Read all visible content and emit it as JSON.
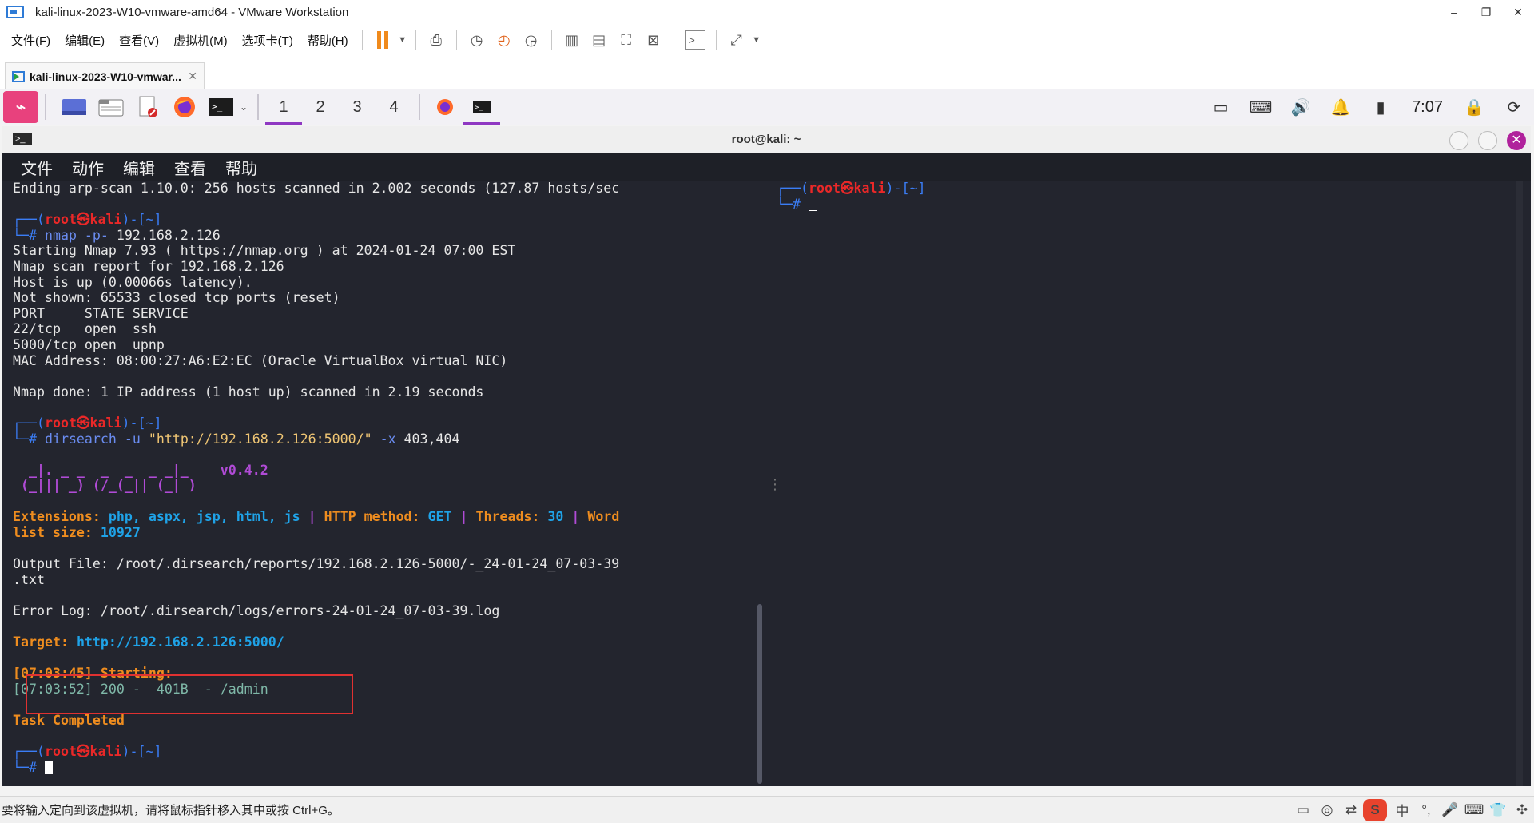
{
  "window": {
    "title": "kali-linux-2023-W10-vmware-amd64 - VMware Workstation",
    "controls": [
      "–",
      "❐",
      "✕"
    ]
  },
  "vm_menu": [
    "文件(F)",
    "编辑(E)",
    "查看(V)",
    "虚拟机(M)",
    "选项卡(T)",
    "帮助(H)"
  ],
  "vm_tab": {
    "label": "kali-linux-2023-W10-vmwar...",
    "close": "✕"
  },
  "kali_panel": {
    "logo": "⌁",
    "workspaces": [
      "1",
      "2",
      "3",
      "4"
    ],
    "active_workspace": 0,
    "clock": "7:07"
  },
  "terminal": {
    "title": "root@kali: ~",
    "icon": ">_",
    "menu": [
      "文件",
      "动作",
      "编辑",
      "查看",
      "帮助"
    ],
    "close": "✕"
  },
  "left_pane": {
    "arp_line": "Ending arp-scan 1.10.0: 256 hosts scanned in 2.002 seconds (127.87 hosts/sec",
    "prompt_top": "┌──(",
    "prompt_user": "root㉿kali",
    "prompt_dir": ")-[~]",
    "prompt_hash": "└─# ",
    "cmd1_name": "nmap",
    "cmd1_args": " -p- ",
    "cmd1_target": "192.168.2.126",
    "nmap_out": [
      "Starting Nmap 7.93 ( https://nmap.org ) at 2024-01-24 07:00 EST",
      "Nmap scan report for 192.168.2.126",
      "Host is up (0.00066s latency).",
      "Not shown: 65533 closed tcp ports (reset)",
      "PORT     STATE SERVICE",
      "22/tcp   open  ssh",
      "5000/tcp open  upnp",
      "MAC Address: 08:00:27:A6:E2:EC (Oracle VirtualBox virtual NIC)",
      "",
      "Nmap done: 1 IP address (1 host up) scanned in 2.19 seconds"
    ],
    "cmd2_name": "dirsearch",
    "cmd2_flag1": " -u ",
    "cmd2_url": "\"http://192.168.2.126:5000/\"",
    "cmd2_flag2": " -x ",
    "cmd2_codes": "403,404",
    "banner1": "  _|. _ _  _  _  _ _|_    ",
    "banner_version": "v0.4.2",
    "banner2": " (_||| _) (/_(_|| (_| )",
    "ext_label": "Extensions: ",
    "ext_value": "php, aspx, jsp, html, js",
    "pipe": " | ",
    "method_label": "HTTP method: ",
    "method_value": "GET",
    "threads_label": "Threads: ",
    "threads_value": "30",
    "word_label": "Word",
    "wordlist_label": "list size: ",
    "wordlist_value": "10927",
    "output_file1": "Output File: /root/.dirsearch/reports/192.168.2.126-5000/-_24-01-24_07-03-39",
    "output_file2": ".txt",
    "error_log": "Error Log: /root/.dirsearch/logs/errors-24-01-24_07-03-39.log",
    "target_label": "Target: ",
    "target_value": "http://192.168.2.126:5000/",
    "starting": "[07:03:45] Starting: ",
    "result": "[07:03:52] 200 -  401B  - /admin",
    "completed": "Task Completed"
  },
  "vm_status": {
    "message": "要将输入定向到该虚拟机，请将鼠标指针移入其中或按 Ctrl+G。",
    "ime": "S",
    "ime_items": [
      "中",
      "°,",
      "🎤",
      "⌨",
      "👕",
      "✣"
    ]
  }
}
